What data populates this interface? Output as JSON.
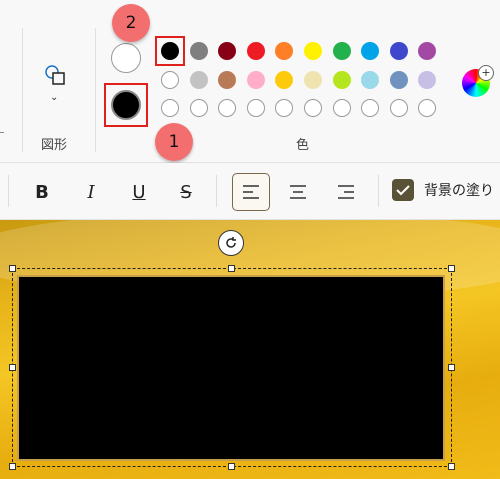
{
  "ribbon": {
    "shapes_label": "図形",
    "color_label": "色",
    "color1": "#000000",
    "color2": "#ffffff",
    "palette_row1": [
      "#000000",
      "#7f7f7f",
      "#880015",
      "#ed1c24",
      "#ff7f27",
      "#fff200",
      "#22b14c",
      "#00a2e8",
      "#3f48cc",
      "#a349a4"
    ],
    "palette_row2": [
      "#ffffff",
      "#c3c3c3",
      "#b97a57",
      "#ffaec9",
      "#ffc90e",
      "#efe4b0",
      "#b5e61d",
      "#99d9ea",
      "#7092be",
      "#c8bfe7"
    ]
  },
  "annotations": {
    "badge1": "1",
    "badge2": "2"
  },
  "toolbar": {
    "bold": "B",
    "italic": "I",
    "underline": "U",
    "strike": "S",
    "fill_bg_label": "背景の塗り"
  },
  "canvas": {
    "shape_fill": "#000000"
  }
}
